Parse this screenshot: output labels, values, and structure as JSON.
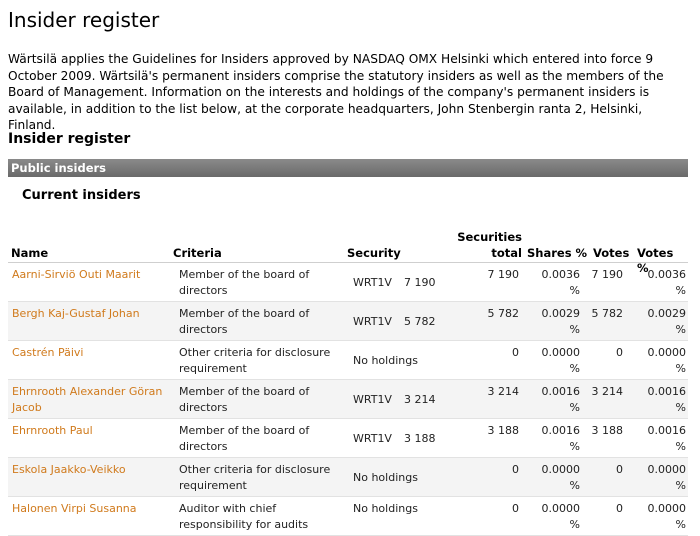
{
  "page_title": "Insider register",
  "intro": "Wärtsilä applies the Guidelines for Insiders approved by NASDAQ OMX Helsinki which entered into force 9 October 2009. Wärtsilä's permanent insiders comprise the statutory insiders as well as the members of the Board of Management. Information on the interests and holdings of the company's permanent insiders is available, in addition to the list below, at the corporate headquarters, John Stenbergin ranta 2, Helsinki, Finland.",
  "section_title": "Insider register",
  "bar_label": "Public insiders",
  "sub_title": "Current insiders",
  "headers": {
    "name": "Name",
    "criteria": "Criteria",
    "security": "Security",
    "securities_line1": "Securities",
    "securities_line2": "total",
    "shares": "Shares %",
    "votes": "Votes",
    "votes_pct": "Votes %"
  },
  "rows": [
    {
      "name": "Aarni-Sirviö Outi Maarit",
      "criteria": "Member of the board of directors",
      "security": "WRT1V",
      "security_value": "7 190",
      "no_holdings": "",
      "total": "7 190",
      "shares": "0.0036 %",
      "votes": "7 190",
      "votes_pct": "0.0036 %"
    },
    {
      "name": "Bergh Kaj-Gustaf Johan",
      "criteria": "Member of the board of directors",
      "security": "WRT1V",
      "security_value": "5 782",
      "no_holdings": "",
      "total": "5 782",
      "shares": "0.0029 %",
      "votes": "5 782",
      "votes_pct": "0.0029 %"
    },
    {
      "name": "Castrén Päivi",
      "criteria": "Other criteria for disclosure requirement",
      "security": "",
      "security_value": "",
      "no_holdings": "No holdings",
      "total": "0",
      "shares": "0.0000 %",
      "votes": "0",
      "votes_pct": "0.0000 %"
    },
    {
      "name": "Ehrnrooth Alexander Göran Jacob",
      "criteria": "Member of the board of directors",
      "security": "WRT1V",
      "security_value": "3 214",
      "no_holdings": "",
      "total": "3 214",
      "shares": "0.0016 %",
      "votes": "3 214",
      "votes_pct": "0.0016 %"
    },
    {
      "name": "Ehrnrooth Paul",
      "criteria": "Member of the board of directors",
      "security": "WRT1V",
      "security_value": "3 188",
      "no_holdings": "",
      "total": "3 188",
      "shares": "0.0016 %",
      "votes": "3 188",
      "votes_pct": "0.0016 %"
    },
    {
      "name": "Eskola Jaakko-Veikko",
      "criteria": "Other criteria for disclosure requirement",
      "security": "",
      "security_value": "",
      "no_holdings": "No holdings",
      "total": "0",
      "shares": "0.0000 %",
      "votes": "0",
      "votes_pct": "0.0000 %"
    },
    {
      "name": "Halonen Virpi Susanna",
      "criteria": "Auditor with chief responsibility for audits",
      "security": "",
      "security_value": "",
      "no_holdings": "No holdings",
      "total": "0",
      "shares": "0.0000 %",
      "votes": "0",
      "votes_pct": "0.0000 %"
    }
  ]
}
